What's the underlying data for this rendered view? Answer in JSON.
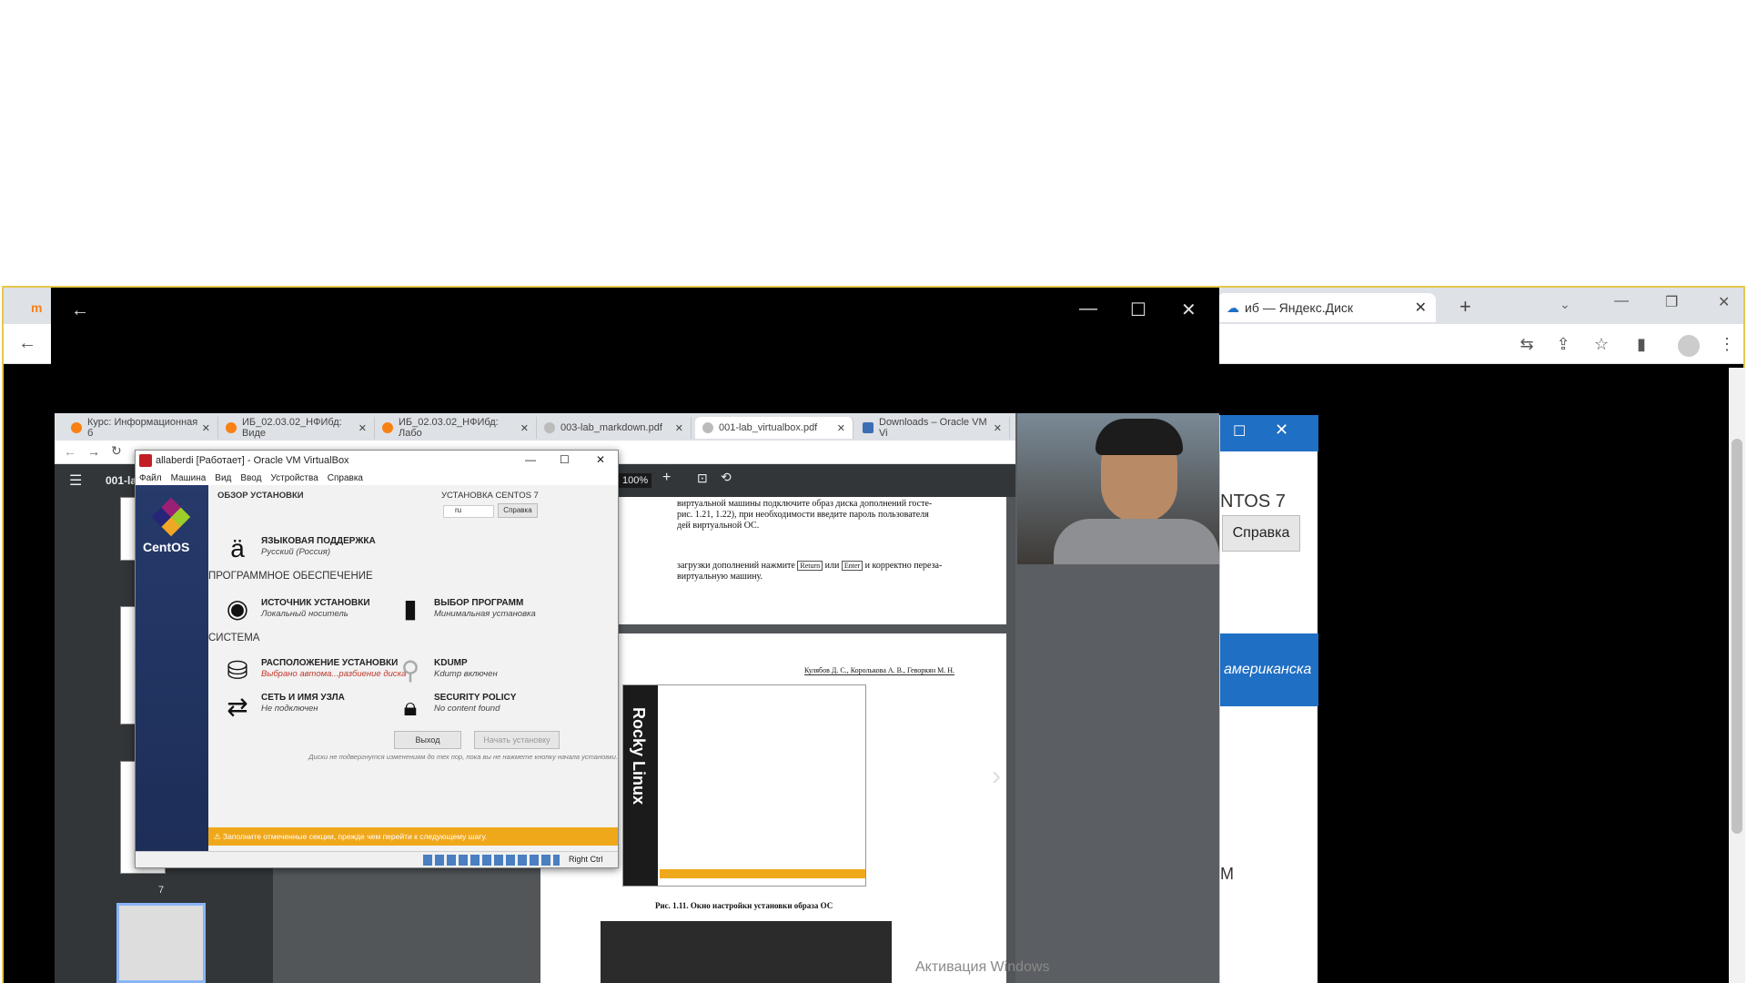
{
  "outer_browser": {
    "tabs": [
      {
        "label": "",
        "favicon": "moodle-icon"
      },
      {
        "label": "иб — Яндекс.Диск"
      }
    ],
    "new_tab": "+",
    "window_controls": [
      "—",
      "❐",
      "✕"
    ]
  },
  "viewer": {
    "back": "←",
    "controls": [
      "—",
      "☐",
      "✕"
    ]
  },
  "inner_browser": {
    "tabs": [
      {
        "label": "Курс: Информационная б"
      },
      {
        "label": "ИБ_02.03.02_НФИбд: Виде"
      },
      {
        "label": "ИБ_02.03.02_НФИбд: Лабо"
      },
      {
        "label": "003-lab_markdown.pdf"
      },
      {
        "label": "001-lab_virtualbox.pdf"
      },
      {
        "label": "Downloads – Oracle VM Vi"
      }
    ],
    "pdf_title": "001-la",
    "zoom": "100%",
    "thumb_page": "7"
  },
  "pdf_text": {
    "line1": "виртуальной машины подключите образ диска дополнений госте-",
    "line2": "рис. 1.21, 1.22), при необходимости введите пароль пользователя",
    "line3": "дей виртуальной ОС.",
    "line4a": "загрузки дополнений нажмите",
    "key1": "Return",
    "or": "или",
    "key2": "Enter",
    "line4b": "и корректно переза-",
    "line5": "виртуальную машину.",
    "authors": "Кулябов Д. С., Королькова А. В., Геворкян М. Н.",
    "caption": "Рис. 1.11. Окно настройки установки образа ОС",
    "rocky": "Rocky Linux"
  },
  "vbox": {
    "title": "allaberdi [Работает] - Oracle VM VirtualBox",
    "menu": [
      "Файл",
      "Машина",
      "Вид",
      "Ввод",
      "Устройства",
      "Справка"
    ],
    "brand": "CentOS",
    "overview": "ОБЗОР УСТАНОВКИ",
    "install_title": "УСТАНОВКА CENTOS 7",
    "kbd": "ru",
    "help": "Справка",
    "lang_title": "ЯЗЫКОВАЯ ПОДДЕРЖКА",
    "lang_sub": "Русский (Россия)",
    "software": "ПРОГРАММНОЕ ОБЕСПЕЧЕНИЕ",
    "source_title": "ИСТОЧНИК УСТАНОВКИ",
    "source_sub": "Локальный носитель",
    "sel_title": "ВЫБОР ПРОГРАММ",
    "sel_sub": "Минимальная установка",
    "system": "СИСТЕМА",
    "dest_title": "РАСПОЛОЖЕНИЕ УСТАНОВКИ",
    "dest_sub": "Выбрано автома...разбиение диска",
    "kdump_title": "KDUMP",
    "kdump_sub": "Kdump включен",
    "net_title": "СЕТЬ И ИМЯ УЗЛА",
    "net_sub": "Не подключен",
    "sec_title": "SECURITY POLICY",
    "sec_sub": "No content found",
    "quit": "Выход",
    "begin": "Начать установку",
    "note": "Диски не подвергнутся изменениям до тех пор, пока вы не нажмете кнопку начала установки.",
    "warning": "Заполните отмеченные секции, прежде чем перейти к следующему шагу.",
    "hostkey": "Right Ctrl"
  },
  "right": {
    "title_partial": "NTOS 7",
    "help": "Справка",
    "lang_partial": "американска",
    "m": "M"
  },
  "watermark": "Активация Windows",
  "colors": {
    "accent_yellow": "#e6c84a",
    "warning": "#f0a81b",
    "centos_blue": "#263a6b",
    "dialog_blue": "#1f6fc4"
  }
}
